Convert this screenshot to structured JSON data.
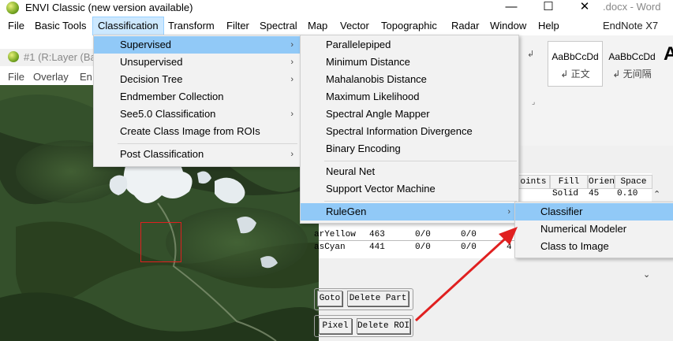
{
  "app": {
    "title": "ENVI Classic (new version available)",
    "minimize": "—",
    "maximize": "☐",
    "close": "✕"
  },
  "menubar": [
    "File",
    "Basic Tools",
    "Classification",
    "Transform",
    "Filter",
    "Spectral",
    "Map",
    "Vector",
    "Topographic",
    "Radar",
    "Window",
    "Help"
  ],
  "word": {
    "title": ".docx - Word",
    "endnote": "EndNote X7",
    "style1": "AaBbCcDd",
    "style1_label": "↲ 正文",
    "style2": "AaBbCcDd",
    "style2_label": "↲ 无间隔",
    "style3": "A"
  },
  "image_window": {
    "title": "#1 (R:Layer (Ba",
    "menu": [
      "File",
      "Overlay",
      "En"
    ],
    "roi_color": "#e02020"
  },
  "classification_menu": {
    "items": [
      {
        "label": "Supervised",
        "submenu": true
      },
      {
        "label": "Unsupervised",
        "submenu": true
      },
      {
        "label": "Decision Tree",
        "submenu": true
      },
      {
        "label": "Endmember Collection",
        "submenu": false
      },
      {
        "label": "See5.0 Classification",
        "submenu": true
      },
      {
        "label": "Create Class Image from ROIs",
        "submenu": false
      },
      {
        "label": "Post Classification",
        "submenu": true
      }
    ]
  },
  "supervised_menu": {
    "items": [
      {
        "label": "Parallelepiped"
      },
      {
        "label": "Minimum Distance"
      },
      {
        "label": "Mahalanobis Distance"
      },
      {
        "label": "Maximum Likelihood"
      },
      {
        "label": "Spectral Angle Mapper"
      },
      {
        "label": "Spectral Information Divergence"
      },
      {
        "label": "Binary Encoding"
      },
      {
        "label": "Neural Net"
      },
      {
        "label": "Support Vector Machine"
      },
      {
        "label": "RuleGen"
      }
    ]
  },
  "rulegen_menu": {
    "items": [
      {
        "label": "Classifier"
      },
      {
        "label": "Numerical Modeler"
      },
      {
        "label": "Class to Image"
      }
    ]
  },
  "roi_table": {
    "headers": [
      "oints",
      "Fill",
      "Orien",
      "Space"
    ],
    "row1": [
      "Solid",
      "45",
      "0.10"
    ],
    "rows": [
      {
        "name": "arYellow",
        "points": "463",
        "a": "0/0",
        "b": "0/0",
        "c": "4"
      },
      {
        "name": "asCyan",
        "points": "441",
        "a": "0/0",
        "b": "0/0",
        "c": "4"
      }
    ],
    "buttons": [
      "Goto",
      "Delete Part",
      "Pixel",
      "Delete ROI"
    ]
  },
  "annotation": {
    "arrow_color": "#e02020"
  }
}
